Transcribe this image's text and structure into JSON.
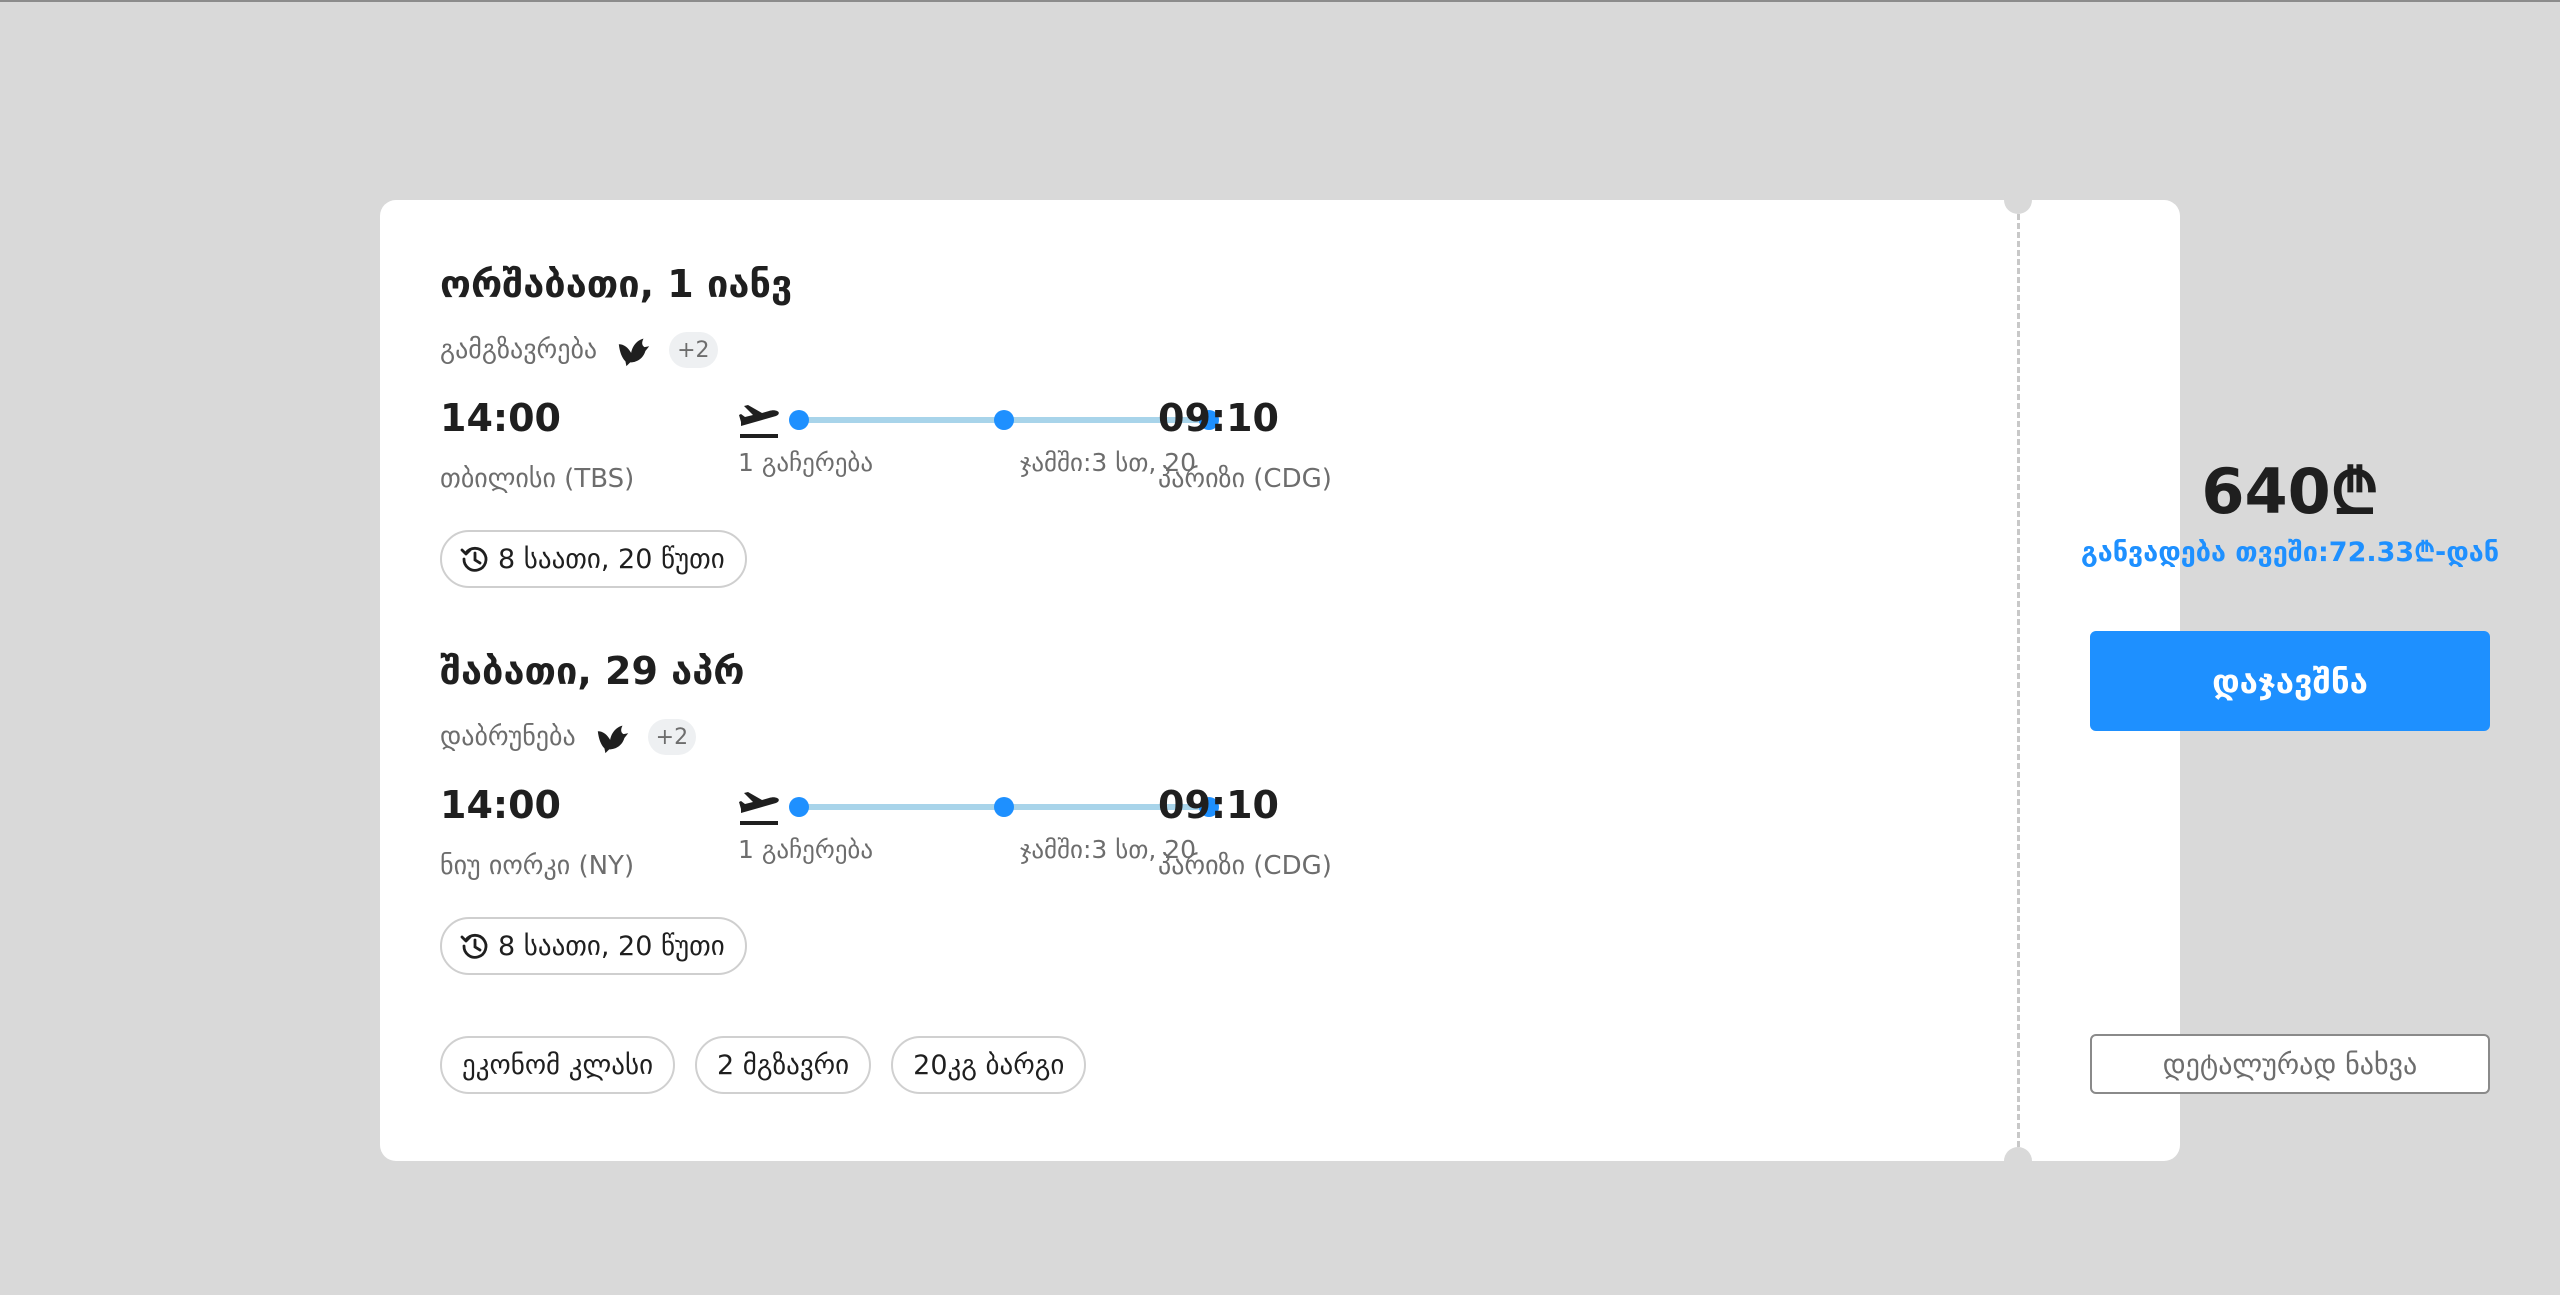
{
  "outbound": {
    "date": "ორშაბათი, 1 იანვ",
    "label": "გამგზავრება",
    "more_airlines": "+2",
    "departure_time": "14:00",
    "departure_city": "თბილისი (TBS)",
    "stops": "1 გაჩერება",
    "total": "ჯამში:3 სთ, 20",
    "arrival_time": "09:10",
    "arrival_city": "პარიზი (CDG)",
    "duration": "8 საათი, 20 წუთი"
  },
  "inbound": {
    "date": "შაბათი, 29 აპრ",
    "label": "დაბრუნება",
    "more_airlines": "+2",
    "departure_time": "14:00",
    "departure_city": "ნიუ იორკი (NY)",
    "stops": "1 გაჩერება",
    "total": "ჯამში:3 სთ, 20",
    "arrival_time": "09:10",
    "arrival_city": "პარიზი (CDG)",
    "duration": "8 საათი, 20 წუთი"
  },
  "tags": [
    "ეკონომ კლასი",
    "2 მგზავრი",
    "20კგ ბარგი"
  ],
  "price": "640₾",
  "installment": "განვადება თვეში:72.33₾-დან",
  "book_label": "დაჯავშნა",
  "details_label": "დეტალურად ნახვა",
  "colors": {
    "accent": "#1e90ff",
    "route_line": "#a8d4ea",
    "background": "#d9d9d9"
  },
  "icons": [
    "bird-icon",
    "plane-departure-icon",
    "clock-history-icon"
  ]
}
